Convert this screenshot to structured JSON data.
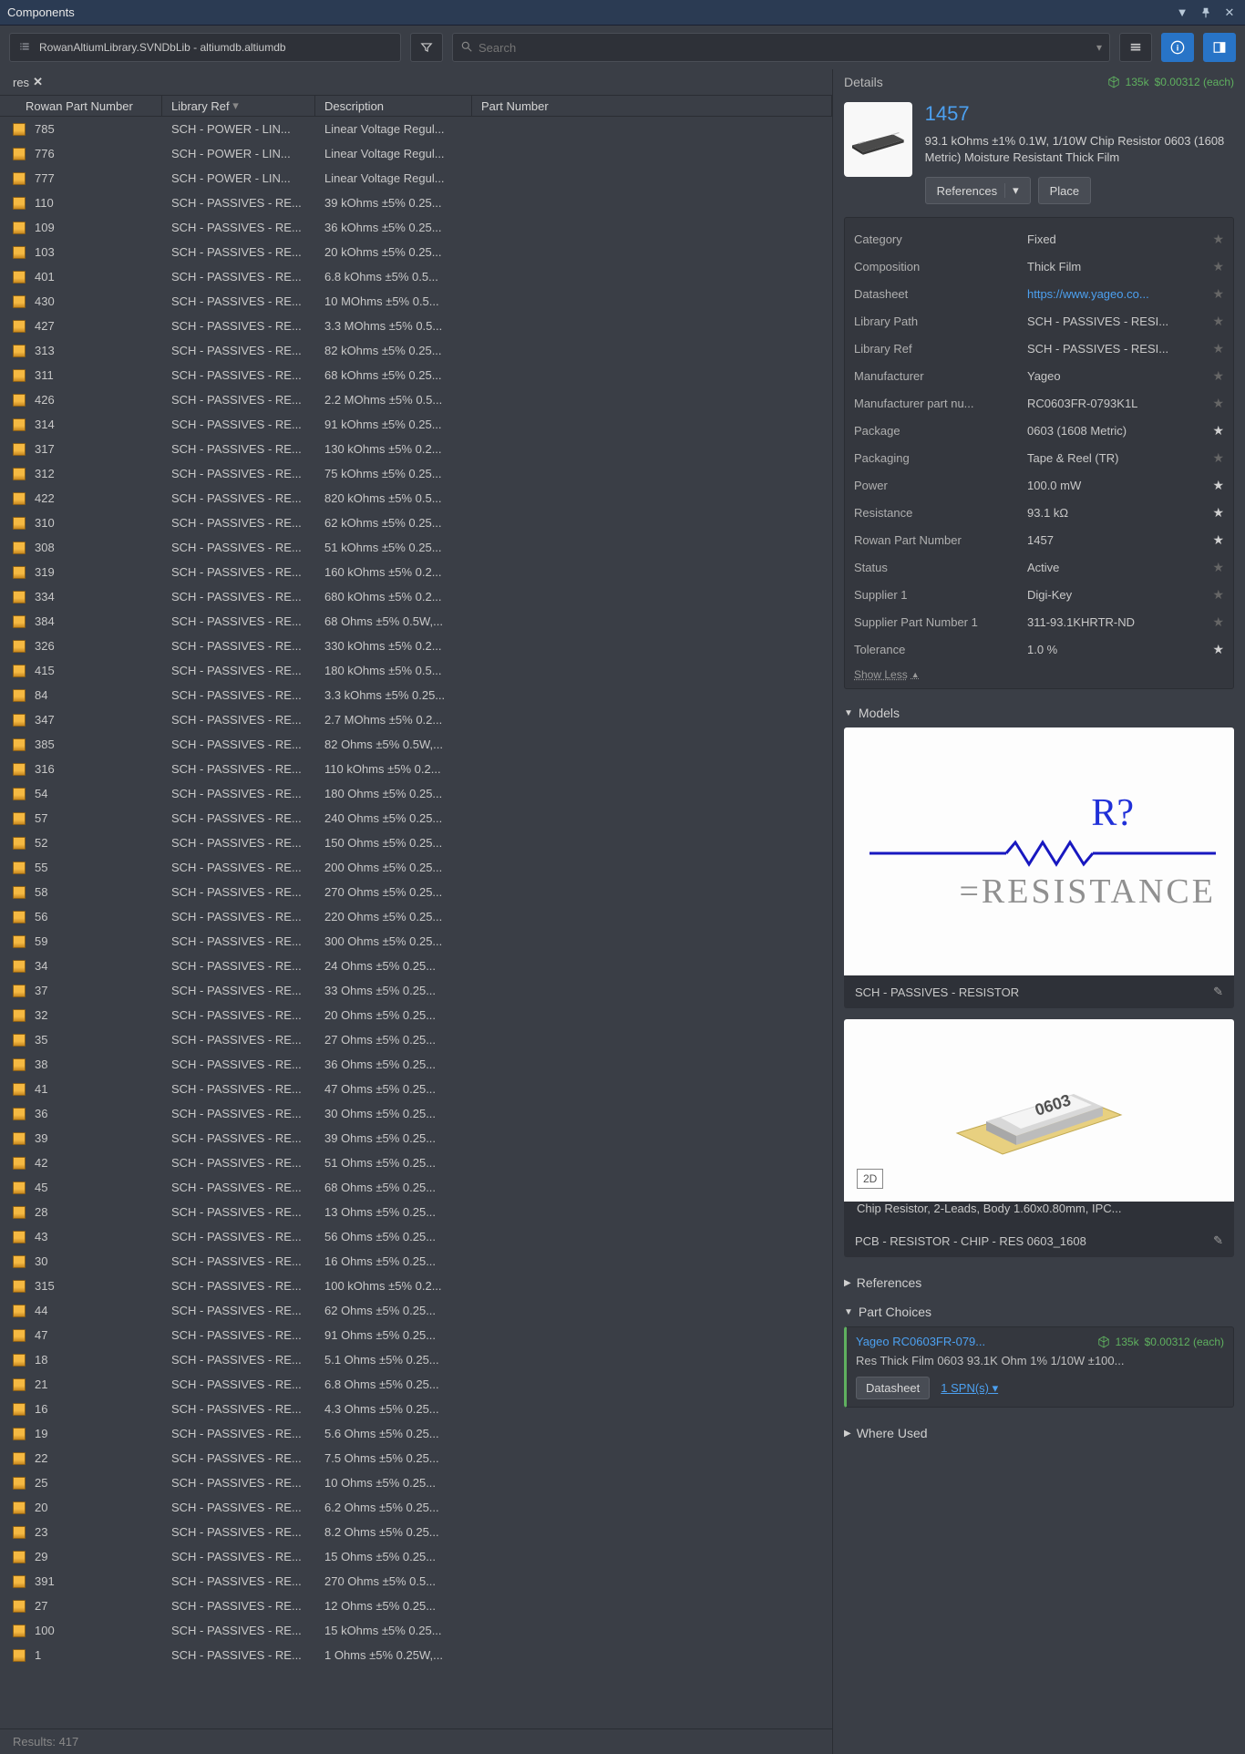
{
  "window": {
    "title": "Components"
  },
  "toolbar": {
    "library_name": "RowanAltiumLibrary.SVNDbLib - altiumdb.altiumdb",
    "search_placeholder": "Search"
  },
  "filter_chip": "res",
  "columns": [
    "Rowan Part Number",
    "Library Ref",
    "Description",
    "Part Number"
  ],
  "rows": [
    {
      "part": "785",
      "lib": "SCH - POWER - LIN...",
      "desc": "Linear Voltage Regul..."
    },
    {
      "part": "776",
      "lib": "SCH - POWER - LIN...",
      "desc": "Linear Voltage Regul..."
    },
    {
      "part": "777",
      "lib": "SCH - POWER - LIN...",
      "desc": "Linear Voltage Regul..."
    },
    {
      "part": "110",
      "lib": "SCH - PASSIVES - RE...",
      "desc": "39 kOhms ±5% 0.25..."
    },
    {
      "part": "109",
      "lib": "SCH - PASSIVES - RE...",
      "desc": "36 kOhms ±5% 0.25..."
    },
    {
      "part": "103",
      "lib": "SCH - PASSIVES - RE...",
      "desc": "20 kOhms ±5% 0.25..."
    },
    {
      "part": "401",
      "lib": "SCH - PASSIVES - RE...",
      "desc": "6.8 kOhms ±5% 0.5..."
    },
    {
      "part": "430",
      "lib": "SCH - PASSIVES - RE...",
      "desc": "10 MOhms ±5% 0.5..."
    },
    {
      "part": "427",
      "lib": "SCH - PASSIVES - RE...",
      "desc": "3.3 MOhms ±5% 0.5..."
    },
    {
      "part": "313",
      "lib": "SCH - PASSIVES - RE...",
      "desc": "82 kOhms ±5% 0.25..."
    },
    {
      "part": "311",
      "lib": "SCH - PASSIVES - RE...",
      "desc": "68 kOhms ±5% 0.25..."
    },
    {
      "part": "426",
      "lib": "SCH - PASSIVES - RE...",
      "desc": "2.2 MOhms ±5% 0.5..."
    },
    {
      "part": "314",
      "lib": "SCH - PASSIVES - RE...",
      "desc": "91 kOhms ±5% 0.25..."
    },
    {
      "part": "317",
      "lib": "SCH - PASSIVES - RE...",
      "desc": "130 kOhms ±5% 0.2..."
    },
    {
      "part": "312",
      "lib": "SCH - PASSIVES - RE...",
      "desc": "75 kOhms ±5% 0.25..."
    },
    {
      "part": "422",
      "lib": "SCH - PASSIVES - RE...",
      "desc": "820 kOhms ±5% 0.5..."
    },
    {
      "part": "310",
      "lib": "SCH - PASSIVES - RE...",
      "desc": "62 kOhms ±5% 0.25..."
    },
    {
      "part": "308",
      "lib": "SCH - PASSIVES - RE...",
      "desc": "51 kOhms ±5% 0.25..."
    },
    {
      "part": "319",
      "lib": "SCH - PASSIVES - RE...",
      "desc": "160 kOhms ±5% 0.2..."
    },
    {
      "part": "334",
      "lib": "SCH - PASSIVES - RE...",
      "desc": "680 kOhms ±5% 0.2..."
    },
    {
      "part": "384",
      "lib": "SCH - PASSIVES - RE...",
      "desc": "68 Ohms ±5% 0.5W,..."
    },
    {
      "part": "326",
      "lib": "SCH - PASSIVES - RE...",
      "desc": "330 kOhms ±5% 0.2..."
    },
    {
      "part": "415",
      "lib": "SCH - PASSIVES - RE...",
      "desc": "180 kOhms ±5% 0.5..."
    },
    {
      "part": "84",
      "lib": "SCH - PASSIVES - RE...",
      "desc": "3.3 kOhms ±5% 0.25..."
    },
    {
      "part": "347",
      "lib": "SCH - PASSIVES - RE...",
      "desc": "2.7 MOhms ±5% 0.2..."
    },
    {
      "part": "385",
      "lib": "SCH - PASSIVES - RE...",
      "desc": "82 Ohms ±5% 0.5W,..."
    },
    {
      "part": "316",
      "lib": "SCH - PASSIVES - RE...",
      "desc": "110 kOhms ±5% 0.2..."
    },
    {
      "part": "54",
      "lib": "SCH - PASSIVES - RE...",
      "desc": "180 Ohms ±5% 0.25..."
    },
    {
      "part": "57",
      "lib": "SCH - PASSIVES - RE...",
      "desc": "240 Ohms ±5% 0.25..."
    },
    {
      "part": "52",
      "lib": "SCH - PASSIVES - RE...",
      "desc": "150 Ohms ±5% 0.25..."
    },
    {
      "part": "55",
      "lib": "SCH - PASSIVES - RE...",
      "desc": "200 Ohms ±5% 0.25..."
    },
    {
      "part": "58",
      "lib": "SCH - PASSIVES - RE...",
      "desc": "270 Ohms ±5% 0.25..."
    },
    {
      "part": "56",
      "lib": "SCH - PASSIVES - RE...",
      "desc": "220 Ohms ±5% 0.25..."
    },
    {
      "part": "59",
      "lib": "SCH - PASSIVES - RE...",
      "desc": "300 Ohms ±5% 0.25..."
    },
    {
      "part": "34",
      "lib": "SCH - PASSIVES - RE...",
      "desc": "24 Ohms ±5% 0.25..."
    },
    {
      "part": "37",
      "lib": "SCH - PASSIVES - RE...",
      "desc": "33 Ohms ±5% 0.25..."
    },
    {
      "part": "32",
      "lib": "SCH - PASSIVES - RE...",
      "desc": "20 Ohms ±5% 0.25..."
    },
    {
      "part": "35",
      "lib": "SCH - PASSIVES - RE...",
      "desc": "27 Ohms ±5% 0.25..."
    },
    {
      "part": "38",
      "lib": "SCH - PASSIVES - RE...",
      "desc": "36 Ohms ±5% 0.25..."
    },
    {
      "part": "41",
      "lib": "SCH - PASSIVES - RE...",
      "desc": "47 Ohms ±5% 0.25..."
    },
    {
      "part": "36",
      "lib": "SCH - PASSIVES - RE...",
      "desc": "30 Ohms ±5% 0.25..."
    },
    {
      "part": "39",
      "lib": "SCH - PASSIVES - RE...",
      "desc": "39 Ohms ±5% 0.25..."
    },
    {
      "part": "42",
      "lib": "SCH - PASSIVES - RE...",
      "desc": "51 Ohms ±5% 0.25..."
    },
    {
      "part": "45",
      "lib": "SCH - PASSIVES - RE...",
      "desc": "68 Ohms ±5% 0.25..."
    },
    {
      "part": "28",
      "lib": "SCH - PASSIVES - RE...",
      "desc": "13 Ohms ±5% 0.25..."
    },
    {
      "part": "43",
      "lib": "SCH - PASSIVES - RE...",
      "desc": "56 Ohms ±5% 0.25..."
    },
    {
      "part": "30",
      "lib": "SCH - PASSIVES - RE...",
      "desc": "16 Ohms ±5% 0.25..."
    },
    {
      "part": "315",
      "lib": "SCH - PASSIVES - RE...",
      "desc": "100 kOhms ±5% 0.2..."
    },
    {
      "part": "44",
      "lib": "SCH - PASSIVES - RE...",
      "desc": "62 Ohms ±5% 0.25..."
    },
    {
      "part": "47",
      "lib": "SCH - PASSIVES - RE...",
      "desc": "91 Ohms ±5% 0.25..."
    },
    {
      "part": "18",
      "lib": "SCH - PASSIVES - RE...",
      "desc": "5.1 Ohms ±5% 0.25..."
    },
    {
      "part": "21",
      "lib": "SCH - PASSIVES - RE...",
      "desc": "6.8 Ohms ±5% 0.25..."
    },
    {
      "part": "16",
      "lib": "SCH - PASSIVES - RE...",
      "desc": "4.3 Ohms ±5% 0.25..."
    },
    {
      "part": "19",
      "lib": "SCH - PASSIVES - RE...",
      "desc": "5.6 Ohms ±5% 0.25..."
    },
    {
      "part": "22",
      "lib": "SCH - PASSIVES - RE...",
      "desc": "7.5 Ohms ±5% 0.25..."
    },
    {
      "part": "25",
      "lib": "SCH - PASSIVES - RE...",
      "desc": "10 Ohms ±5% 0.25..."
    },
    {
      "part": "20",
      "lib": "SCH - PASSIVES - RE...",
      "desc": "6.2 Ohms ±5% 0.25..."
    },
    {
      "part": "23",
      "lib": "SCH - PASSIVES - RE...",
      "desc": "8.2 Ohms ±5% 0.25..."
    },
    {
      "part": "29",
      "lib": "SCH - PASSIVES - RE...",
      "desc": "15 Ohms ±5% 0.25..."
    },
    {
      "part": "391",
      "lib": "SCH - PASSIVES - RE...",
      "desc": "270 Ohms ±5% 0.5..."
    },
    {
      "part": "27",
      "lib": "SCH - PASSIVES - RE...",
      "desc": "12 Ohms ±5% 0.25..."
    },
    {
      "part": "100",
      "lib": "SCH - PASSIVES - RE...",
      "desc": "15 kOhms ±5% 0.25..."
    },
    {
      "part": "1",
      "lib": "SCH - PASSIVES - RE...",
      "desc": "1 Ohms ±5% 0.25W,..."
    }
  ],
  "results_count": "Results: 417",
  "details": {
    "panel_title": "Details",
    "stock_qty": "135k",
    "stock_price": "$0.00312 (each)",
    "part_id": "1457",
    "description": "93.1 kOhms ±1% 0.1W, 1/10W Chip Resistor 0603 (1608 Metric) Moisture Resistant Thick Film",
    "references_btn": "References",
    "place_btn": "Place",
    "show_less": "Show Less",
    "properties": [
      {
        "k": "Category",
        "v": "Fixed",
        "star": false,
        "link": false
      },
      {
        "k": "Composition",
        "v": "Thick Film",
        "star": false,
        "link": false
      },
      {
        "k": "Datasheet",
        "v": "https://www.yageo.co...",
        "star": false,
        "link": true
      },
      {
        "k": "Library Path",
        "v": "SCH - PASSIVES - RESI...",
        "star": false,
        "link": false
      },
      {
        "k": "Library Ref",
        "v": "SCH - PASSIVES - RESI...",
        "star": false,
        "link": false
      },
      {
        "k": "Manufacturer",
        "v": "Yageo",
        "star": false,
        "link": false
      },
      {
        "k": "Manufacturer part nu...",
        "v": "RC0603FR-0793K1L",
        "star": false,
        "link": false
      },
      {
        "k": "Package",
        "v": "0603 (1608 Metric)",
        "star": true,
        "link": false
      },
      {
        "k": "Packaging",
        "v": "Tape & Reel (TR)",
        "star": false,
        "link": false
      },
      {
        "k": "Power",
        "v": "100.0 mW",
        "star": true,
        "link": false
      },
      {
        "k": "Resistance",
        "v": "93.1 kΩ",
        "star": true,
        "link": false
      },
      {
        "k": "Rowan Part Number",
        "v": "1457",
        "star": true,
        "link": false
      },
      {
        "k": "Status",
        "v": "Active",
        "star": false,
        "link": false
      },
      {
        "k": "Supplier 1",
        "v": "Digi-Key",
        "star": false,
        "link": false
      },
      {
        "k": "Supplier Part Number 1",
        "v": "311-93.1KHRTR-ND",
        "star": false,
        "link": false
      },
      {
        "k": "Tolerance",
        "v": "1.0 %",
        "star": true,
        "link": false
      }
    ]
  },
  "models": {
    "header": "Models",
    "sch": {
      "designator": "R?",
      "value_label": "=RESISTANCE",
      "caption": "SCH - PASSIVES - RESISTOR"
    },
    "pcb": {
      "badge": "2D",
      "desc": "Chip Resistor, 2-Leads, Body 1.60x0.80mm, IPC...",
      "caption": "PCB - RESISTOR - CHIP - RES 0603_1608"
    }
  },
  "references_section": "References",
  "part_choices": {
    "header": "Part Choices",
    "name": "Yageo RC0603FR-079...",
    "qty": "135k",
    "price": "$0.00312 (each)",
    "desc": "Res Thick Film 0603 93.1K Ohm 1% 1/10W ±100...",
    "datasheet_btn": "Datasheet",
    "spn_link": "1 SPN(s)"
  },
  "where_used": "Where Used"
}
